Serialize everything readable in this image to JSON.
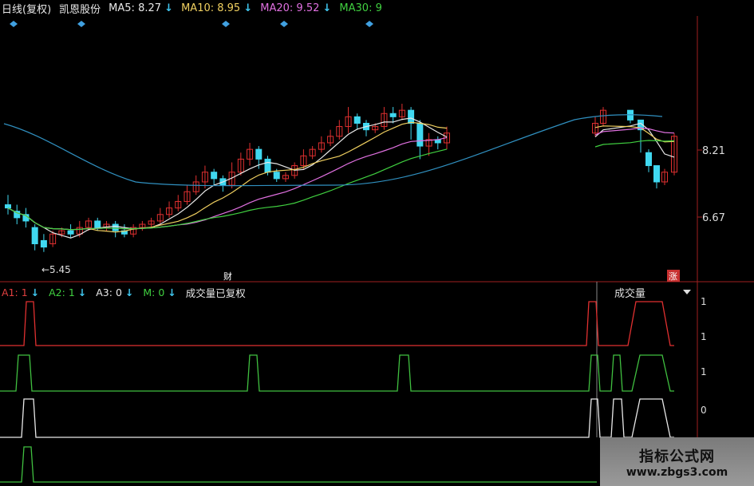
{
  "header": {
    "period": "日线(复权)",
    "stock_name": "凯恩股份",
    "ma": [
      {
        "label": "MA5:",
        "value": "8.27",
        "arrow": "↓",
        "color": "#e8e8e8"
      },
      {
        "label": "MA10:",
        "value": "8.95",
        "arrow": "↓",
        "color": "#f0d060"
      },
      {
        "label": "MA20:",
        "value": "9.52",
        "arrow": "↓",
        "color": "#e070e0"
      },
      {
        "label": "MA30:",
        "value": "9",
        "arrow": "",
        "color": "#40d040"
      }
    ]
  },
  "sub_header": {
    "items": [
      {
        "label": "A1:",
        "value": "1",
        "arrow": "↓",
        "color": "#e04040"
      },
      {
        "label": "A2:",
        "value": "1",
        "arrow": "↓",
        "color": "#40d040"
      },
      {
        "label": "A3:",
        "value": "0",
        "arrow": "↓",
        "color": "#e8e8e8"
      },
      {
        "label": "M:",
        "value": "0",
        "arrow": "↓",
        "color": "#40d040"
      }
    ],
    "note": "成交量已复权"
  },
  "volume_dropdown": {
    "label": "成交量",
    "icon": "chevron-down-icon"
  },
  "markers": {
    "finance": "财",
    "rise": "涨"
  },
  "watermark": {
    "line1": "指标公式网",
    "line2": "www.zbgs3.com"
  },
  "colors": {
    "up": "#e03030",
    "down": "#40d8f0",
    "ma5": "#e8e8e8",
    "ma10": "#f0d060",
    "ma20": "#e070e0",
    "ma30": "#40d040",
    "ma60": "#3090c0",
    "axis": "#a02020",
    "a1": "#e03030",
    "a2": "#40c040",
    "a3": "#e8e8e8",
    "m": "#40c040",
    "diamond": "#40a0e0"
  },
  "chart_data": [
    {
      "type": "candlestick",
      "yticks": [
        "8.21",
        "6.67"
      ],
      "low_annotation": "5.45",
      "price_range": [
        5.1,
        10.0
      ],
      "candles": [
        [
          6.9,
          6.8,
          7.2,
          6.6
        ],
        [
          6.7,
          6.5,
          6.9,
          6.3
        ],
        [
          6.6,
          6.4,
          6.8,
          6.2
        ],
        [
          6.2,
          5.7,
          6.3,
          5.5
        ],
        [
          5.8,
          5.6,
          6.0,
          5.45
        ],
        [
          5.7,
          6.0,
          6.1,
          5.6
        ],
        [
          6.0,
          6.1,
          6.2,
          5.9
        ],
        [
          6.1,
          6.0,
          6.3,
          5.9
        ],
        [
          6.0,
          6.2,
          6.4,
          5.9
        ],
        [
          6.2,
          6.4,
          6.5,
          6.1
        ],
        [
          6.4,
          6.2,
          6.5,
          6.1
        ],
        [
          6.2,
          6.3,
          6.4,
          6.1
        ],
        [
          6.3,
          6.1,
          6.4,
          5.9
        ],
        [
          6.1,
          6.0,
          6.3,
          5.9
        ],
        [
          6.0,
          6.2,
          6.3,
          5.9
        ],
        [
          6.2,
          6.3,
          6.4,
          6.1
        ],
        [
          6.3,
          6.4,
          6.5,
          6.2
        ],
        [
          6.4,
          6.6,
          6.8,
          6.3
        ],
        [
          6.6,
          6.8,
          7.0,
          6.5
        ],
        [
          6.8,
          7.0,
          7.2,
          6.7
        ],
        [
          7.0,
          7.3,
          7.5,
          6.9
        ],
        [
          7.3,
          7.6,
          7.8,
          7.2
        ],
        [
          7.6,
          7.9,
          8.1,
          7.4
        ],
        [
          7.9,
          7.7,
          8.0,
          7.5
        ],
        [
          7.7,
          7.5,
          7.8,
          7.3
        ],
        [
          7.5,
          7.9,
          8.2,
          7.4
        ],
        [
          7.9,
          8.3,
          8.5,
          7.8
        ],
        [
          8.3,
          8.6,
          8.8,
          8.1
        ],
        [
          8.6,
          8.3,
          8.7,
          8.0
        ],
        [
          8.3,
          7.9,
          8.4,
          7.8
        ],
        [
          7.9,
          7.7,
          8.0,
          7.6
        ],
        [
          7.7,
          7.8,
          7.9,
          7.6
        ],
        [
          7.8,
          8.1,
          8.2,
          7.7
        ],
        [
          8.1,
          8.4,
          8.6,
          8.0
        ],
        [
          8.4,
          8.6,
          8.7,
          8.3
        ],
        [
          8.6,
          8.8,
          9.0,
          8.5
        ],
        [
          8.8,
          9.0,
          9.2,
          8.7
        ],
        [
          9.0,
          9.3,
          9.5,
          8.9
        ],
        [
          9.3,
          9.6,
          9.9,
          9.1
        ],
        [
          9.6,
          9.4,
          9.7,
          9.2
        ],
        [
          9.4,
          9.2,
          9.5,
          9.0
        ],
        [
          9.2,
          9.3,
          9.4,
          9.1
        ],
        [
          9.3,
          9.7,
          9.9,
          9.2
        ],
        [
          9.7,
          9.6,
          9.9,
          9.4
        ],
        [
          9.6,
          9.8,
          10.0,
          9.5
        ],
        [
          9.8,
          9.4,
          9.9,
          8.9
        ],
        [
          9.4,
          8.7,
          9.5,
          8.3
        ],
        [
          8.7,
          8.9,
          9.1,
          8.4
        ],
        [
          8.9,
          8.8,
          9.0,
          8.6
        ],
        [
          8.8,
          9.1,
          9.3,
          8.6
        ],
        [
          9.1,
          9.4,
          9.6,
          9.0
        ],
        [
          9.4,
          9.8,
          9.9,
          9.3
        ],
        [
          9.8,
          9.5,
          9.7,
          9.4
        ],
        [
          9.5,
          9.2,
          9.5,
          8.5
        ],
        [
          8.5,
          8.1,
          8.6,
          7.9
        ],
        [
          8.1,
          7.6,
          8.0,
          7.4
        ],
        [
          7.6,
          7.9,
          8.0,
          7.5
        ],
        [
          7.9,
          9.0,
          9.1,
          7.8
        ]
      ]
    },
    {
      "type": "line",
      "series": [
        {
          "name": "A1",
          "values": [
            0,
            0,
            0,
            0,
            1,
            1,
            0,
            0,
            0,
            0,
            0,
            0,
            0,
            0,
            0,
            0,
            0,
            0,
            0,
            0,
            0,
            0,
            0,
            0,
            0,
            0,
            0,
            0,
            0,
            0,
            0,
            0,
            0,
            0,
            0,
            0,
            0,
            0,
            0,
            0,
            0,
            0,
            0,
            0,
            0,
            0,
            0,
            0,
            0,
            0,
            0,
            0,
            0,
            0,
            0,
            0,
            0,
            0,
            0,
            0,
            0,
            0,
            0,
            0,
            0,
            0,
            0,
            0,
            0,
            0,
            0,
            0,
            0,
            0,
            0,
            0,
            0,
            0,
            0,
            0,
            0,
            0,
            0,
            0,
            0,
            0,
            0,
            0,
            0,
            0,
            0,
            0,
            0,
            0,
            0,
            0,
            0,
            0,
            0,
            0,
            0,
            0,
            0,
            0,
            0,
            0,
            0,
            0,
            0,
            0,
            0,
            0,
            0,
            0,
            0,
            0,
            0,
            0,
            0,
            0,
            0,
            0,
            0,
            0,
            0,
            0,
            0,
            0,
            0,
            0,
            0,
            0,
            0,
            0,
            0,
            0,
            0,
            0,
            0,
            0,
            0,
            0,
            0,
            0,
            0,
            0,
            0,
            0,
            0,
            0,
            0,
            0,
            0,
            0,
            0,
            0,
            0,
            0,
            0,
            0,
            0,
            0,
            0,
            0,
            1,
            1,
            0,
            0,
            0,
            0,
            1,
            1,
            1,
            1,
            1,
            1,
            1,
            1,
            0
          ]
        }
      ]
    }
  ]
}
